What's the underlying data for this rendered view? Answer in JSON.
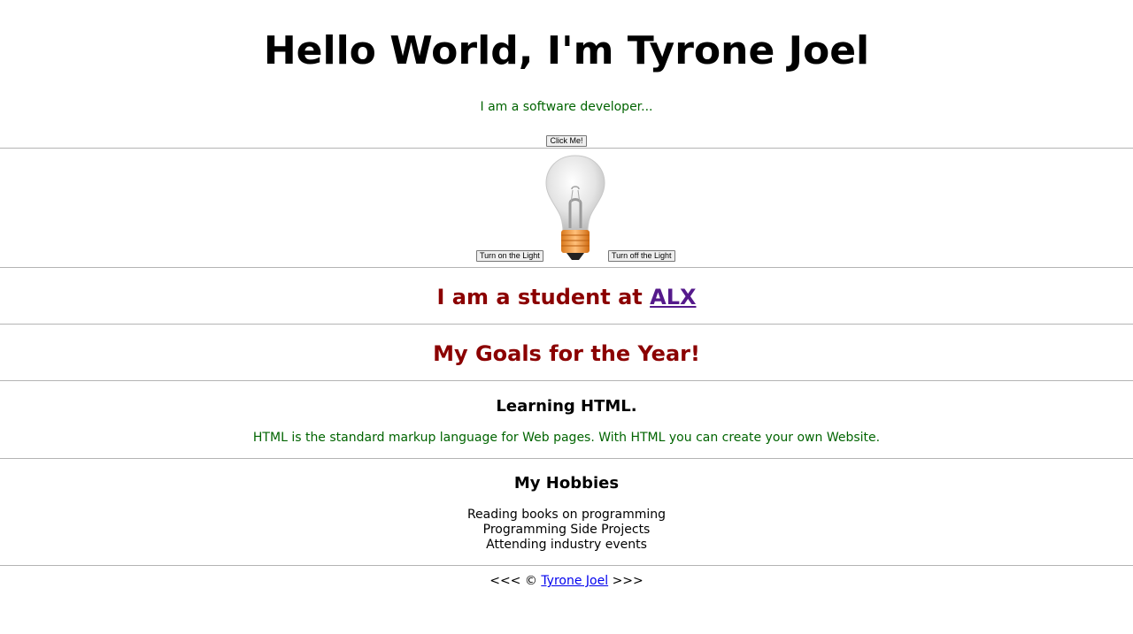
{
  "header": {
    "title": "Hello World, I'm Tyrone Joel",
    "subtitle": "I am a software developer...",
    "click_button": "Click Me!"
  },
  "bulb": {
    "on_button": "Turn on the Light",
    "off_button": "Turn off the Light",
    "state": "off"
  },
  "student": {
    "prefix": "I am a student at ",
    "link": "ALX"
  },
  "goals": {
    "heading": "My Goals for the Year!"
  },
  "learning": {
    "heading": "Learning HTML.",
    "text": "HTML is the standard markup language for Web pages. With HTML you can create your own Website."
  },
  "hobbies": {
    "heading": "My Hobbies",
    "items": [
      "Reading books on programming",
      "Programming Side Projects",
      "Attending industry events"
    ]
  },
  "footer": {
    "prefix": "<<< © ",
    "link": "Tyrone Joel",
    "suffix": " >>>"
  },
  "colors": {
    "green_text": "#006400",
    "red_heading": "#8b0000",
    "visited_link": "#551a8b",
    "link": "#0000ee"
  }
}
